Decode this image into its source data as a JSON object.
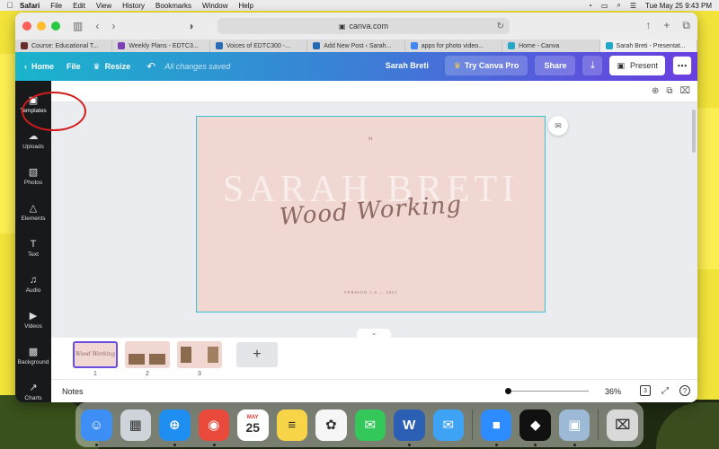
{
  "menubar": {
    "app": "Safari",
    "items": [
      "File",
      "Edit",
      "View",
      "History",
      "Bookmarks",
      "Window",
      "Help"
    ],
    "datetime": "Tue May 25  9:43 PM"
  },
  "browser": {
    "url": "canva.com",
    "tabs": [
      {
        "title": "Course: Educational T...",
        "color": "#6a2b2b"
      },
      {
        "title": "Weekly Plans - EDTC3...",
        "color": "#7b3fb8"
      },
      {
        "title": "Voices of EDTC300 -...",
        "color": "#2a6ab5"
      },
      {
        "title": "Add New Post ‹ Sarah...",
        "color": "#2a6ab5"
      },
      {
        "title": "apps for photo video...",
        "color": "#4285f4"
      },
      {
        "title": "Home - Canva",
        "color": "#22a7c9"
      },
      {
        "title": "Sarah Breti - Presentat...",
        "color": "#22a7c9"
      }
    ],
    "active_tab": 6
  },
  "canva": {
    "home": "Home",
    "file": "File",
    "resize": "Resize",
    "saved_status": "All changes saved",
    "user": "Sarah Breti",
    "try_pro": "Try Canva Pro",
    "share": "Share",
    "present": "Present"
  },
  "sidebar": {
    "items": [
      {
        "label": "Templates",
        "icon": "templates-icon",
        "glyph": "▣"
      },
      {
        "label": "Uploads",
        "icon": "upload-icon",
        "glyph": "☁"
      },
      {
        "label": "Photos",
        "icon": "photos-icon",
        "glyph": "▧"
      },
      {
        "label": "Elements",
        "icon": "elements-icon",
        "glyph": "△"
      },
      {
        "label": "Text",
        "icon": "text-icon",
        "glyph": "T"
      },
      {
        "label": "Audio",
        "icon": "audio-icon",
        "glyph": "♫"
      },
      {
        "label": "Videos",
        "icon": "videos-icon",
        "glyph": "▶"
      },
      {
        "label": "Background",
        "icon": "background-icon",
        "glyph": "▩"
      },
      {
        "label": "Charts",
        "icon": "charts-icon",
        "glyph": "↗"
      }
    ]
  },
  "slide": {
    "number": "01",
    "bg_name": "SARAH BRETI",
    "title": "Wood Working",
    "version": "VERSION 1.0 — 2021",
    "color": "#f0d7d2"
  },
  "pages": [
    {
      "label": "1"
    },
    {
      "label": "2"
    },
    {
      "label": "3"
    }
  ],
  "bottom": {
    "notes": "Notes",
    "zoom": "36%",
    "page_count": "3",
    "help": "?"
  },
  "dock": [
    {
      "name": "finder",
      "glyph": "☺",
      "color": "#3d8ff5"
    },
    {
      "name": "launchpad",
      "glyph": "▦",
      "color": "#cfd3da"
    },
    {
      "name": "safari",
      "glyph": "⊕",
      "color": "#1e8ef0"
    },
    {
      "name": "chrome",
      "glyph": "◉",
      "color": "#e94a3c"
    },
    {
      "name": "calendar",
      "glyph": "25",
      "color": "#ffffff"
    },
    {
      "name": "notes",
      "glyph": "≡",
      "color": "#f7d448"
    },
    {
      "name": "photos",
      "glyph": "✿",
      "color": "#f6f6f6"
    },
    {
      "name": "messages",
      "glyph": "✉",
      "color": "#34c759"
    },
    {
      "name": "word",
      "glyph": "W",
      "color": "#2b5fb3"
    },
    {
      "name": "mail",
      "glyph": "✉",
      "color": "#3ea2f5"
    },
    {
      "name": "zoom",
      "glyph": "■",
      "color": "#2d8cff"
    },
    {
      "name": "filmora",
      "glyph": "◆",
      "color": "#111111"
    },
    {
      "name": "preview",
      "glyph": "▣",
      "color": "#9cb9d6"
    },
    {
      "name": "trash",
      "glyph": "⌧",
      "color": "#d9d9d9"
    }
  ],
  "calendar_month": "MAY"
}
